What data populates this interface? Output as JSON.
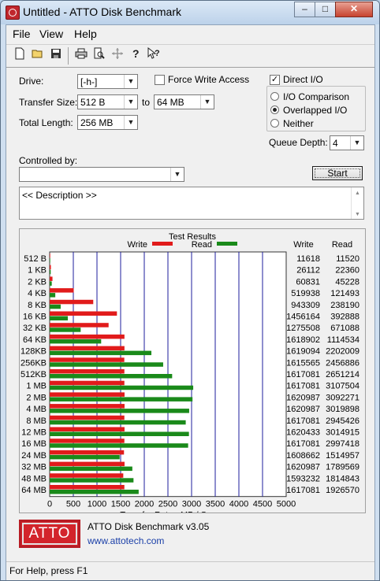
{
  "window": {
    "title": "Untitled - ATTO Disk Benchmark",
    "min": "–",
    "max": "□",
    "close": "✕"
  },
  "menu": [
    {
      "label": "File"
    },
    {
      "label": "View"
    },
    {
      "label": "Help"
    }
  ],
  "toolbar_icons": [
    "new-icon",
    "open-icon",
    "save-icon",
    "print-icon",
    "print-preview-icon",
    "move-icon",
    "help-icon",
    "context-help-icon"
  ],
  "drive": {
    "label": "Drive:",
    "value": "[-h-]"
  },
  "force_write": {
    "label": "Force Write Access",
    "checked": false
  },
  "direct_io": {
    "label": "Direct I/O",
    "checked": true
  },
  "transfer_size": {
    "label": "Transfer Size:",
    "from": "512 B",
    "to_label": "to",
    "to": "64 MB"
  },
  "total_length": {
    "label": "Total Length:",
    "value": "256 MB"
  },
  "io_mode": {
    "options": [
      "I/O Comparison",
      "Overlapped I/O",
      "Neither"
    ],
    "selected": "Overlapped I/O"
  },
  "queue_depth": {
    "label": "Queue Depth:",
    "value": "4"
  },
  "controlled_by": {
    "label": "Controlled by:",
    "value": ""
  },
  "start_button": "Start",
  "description": "<< Description >>",
  "results": {
    "title": "Test Results",
    "write_legend": "Write",
    "read_legend": "Read",
    "col_write": "Write",
    "col_read": "Read"
  },
  "chart_data": {
    "type": "bar",
    "title": "Test Results",
    "xlabel": "Transfer Rate - MB / Sec",
    "xlim": [
      0,
      5000
    ],
    "x_ticks": [
      0,
      500,
      1000,
      1500,
      2000,
      2500,
      3000,
      3500,
      4000,
      4500,
      5000
    ],
    "grid": true,
    "legend": "top",
    "colors": {
      "write": "#e11b1b",
      "read": "#1a8a1a",
      "grid": "#1c1c9c"
    },
    "categories": [
      "512 B",
      "1 KB",
      "2 KB",
      "4 KB",
      "8 KB",
      "16 KB",
      "32 KB",
      "64 KB",
      "128KB",
      "256KB",
      "512KB",
      "1 MB",
      "2 MB",
      "4 MB",
      "8 MB",
      "12 MB",
      "16 MB",
      "24 MB",
      "32 MB",
      "48 MB",
      "64 MB"
    ],
    "series": [
      {
        "name": "Write",
        "values": [
          11618,
          26112,
          60831,
          519938,
          943309,
          1456164,
          1275508,
          1618902,
          1619094,
          1615565,
          1617081,
          1617081,
          1620987,
          1620987,
          1617081,
          1620433,
          1617081,
          1608662,
          1620987,
          1593232,
          1617081
        ]
      },
      {
        "name": "Read",
        "values": [
          11520,
          22360,
          45228,
          121493,
          238190,
          392888,
          671088,
          1114534,
          2202009,
          2456886,
          2651214,
          3107504,
          3092271,
          3019898,
          2945426,
          3014915,
          2997418,
          1514957,
          1789569,
          1814843,
          1926570
        ]
      }
    ]
  },
  "footer": {
    "logo": "ATTO",
    "product": "ATTO Disk Benchmark v3.05",
    "url": "www.attotech.com"
  },
  "status": "For Help, press F1"
}
